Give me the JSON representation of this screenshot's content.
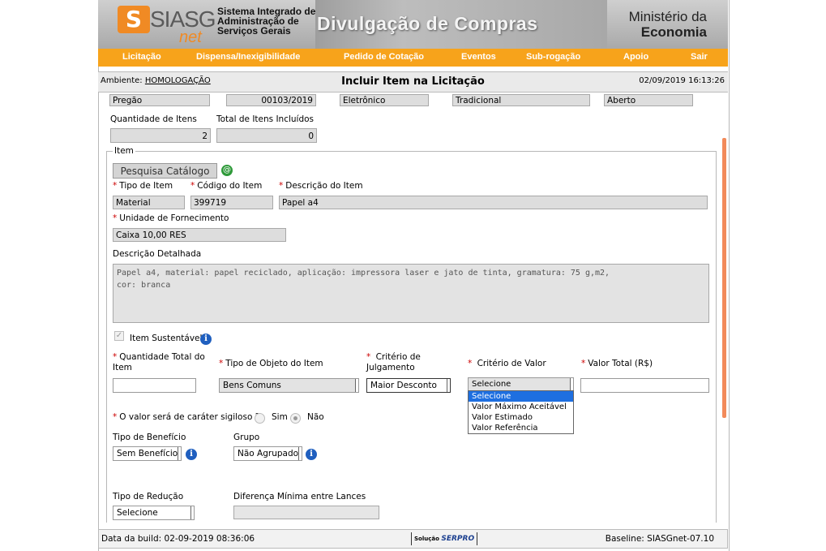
{
  "header": {
    "logo_main": "SIASG",
    "logo_sub": "net",
    "system_name": "Sistema Integrado de Administração de Serviços Gerais",
    "banner_title": "Divulgação de Compras",
    "ministry_line1": "Ministério da",
    "ministry_line2": "Economia"
  },
  "menu": [
    "Licitação",
    "Dispensa/Inexigibilidade",
    "Pedido de Cotação",
    "Eventos",
    "Sub-rogação",
    "Apoio",
    "Sair"
  ],
  "status": {
    "ambiente_label": "Ambiente:",
    "ambiente_value": "HOMOLOGAÇÃO",
    "title": "Incluir Item na Licitação",
    "datetime": "02/09/2019 16:13:26"
  },
  "summary": {
    "modalidade": "Pregão",
    "numero": "00103/2019",
    "forma": "Eletrônico",
    "tipo": "Tradicional",
    "situacao": "Aberto",
    "qtd_itens_label": "Quantidade de Itens",
    "qtd_itens_value": "2",
    "total_incluidos_label": "Total de Itens Incluídos",
    "total_incluidos_value": "0"
  },
  "item": {
    "legend": "Item",
    "pesquisa_button": "Pesquisa Catálogo",
    "tipo_label": "Tipo de Item",
    "tipo_value": "Material",
    "codigo_label": "Código do Item",
    "codigo_value": "399719",
    "descricao_label": "Descrição do Item",
    "descricao_value": "Papel a4",
    "unidade_label": "Unidade de Fornecimento",
    "unidade_value": "Caixa 10,00 RES",
    "detalhada_label": "Descrição Detalhada",
    "detalhada_line1": "Papel a4, material: papel reciclado, aplicação: impressora laser e jato de tinta, gramatura: 75 g,m2,",
    "detalhada_line2": "cor: branca",
    "sustentavel_label": "Item Sustentável",
    "qtd_total_label1": "Quantidade Total do",
    "qtd_total_label2": "Item",
    "tipo_objeto_label": "Tipo de Objeto do Item",
    "tipo_objeto_value": "Bens Comuns",
    "criterio_julg_label1": "Critério de",
    "criterio_julg_label2": "Julgamento",
    "criterio_julg_value": "Maior Desconto",
    "criterio_valor_label": "Critério de Valor",
    "criterio_valor_value": "Selecione",
    "criterio_valor_options": [
      "Selecione",
      "Valor Máximo Aceitável",
      "Valor Estimado",
      "Valor Referência"
    ],
    "valor_total_label": "Valor Total (R$)",
    "sigiloso_label": "O valor será de caráter sigiloso ?",
    "sim_label": "Sim",
    "nao_label": "Não",
    "beneficio_label": "Tipo de Benefício",
    "beneficio_value": "Sem Benefício",
    "grupo_label": "Grupo",
    "grupo_value": "Não Agrupado",
    "reducao_label": "Tipo de Redução",
    "reducao_value": "Selecione",
    "diferenca_label": "Diferença Mínima entre Lances"
  },
  "footer": {
    "build": "Data da build: 02-09-2019 08:36:06",
    "solucao": "Solução",
    "serpro": "SERPRO",
    "baseline": "Baseline: SIASGnet-07.10"
  }
}
